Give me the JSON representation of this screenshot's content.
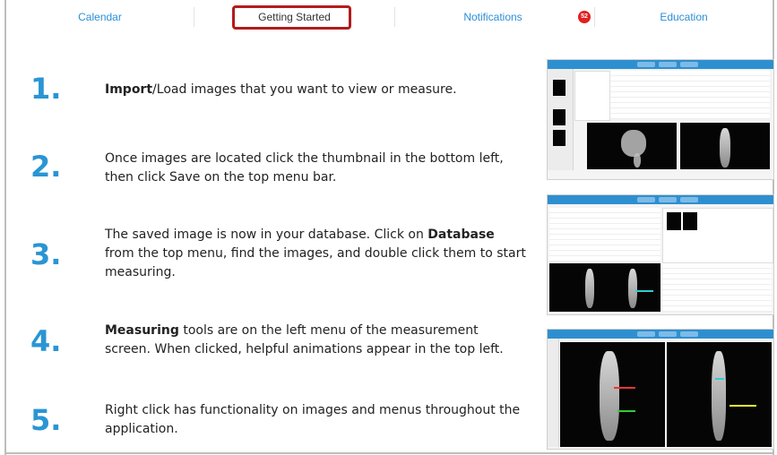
{
  "tabs": [
    {
      "label": "Calendar"
    },
    {
      "label": "Getting Started"
    },
    {
      "label": "Notifications"
    },
    {
      "label": "Education"
    }
  ],
  "notifications_badge": "52",
  "colors": {
    "accent": "#2a95d3",
    "highlight": "#b31b1b",
    "badge": "#e02020"
  },
  "steps": [
    {
      "num": "1.",
      "bold": "Import",
      "text": "/Load images that you want to view or measure."
    },
    {
      "num": "2.",
      "text": "Once images are located click the thumbnail in the bottom left, then click Save on the top menu bar."
    },
    {
      "num": "3.",
      "pre": "The saved image is now in your database. Click on ",
      "bold": "Database",
      "post": " from the top menu, find the images, and double click them to start measuring."
    },
    {
      "num": "4.",
      "bold": "Measuring",
      "text": " tools are on the left menu of the measurement screen. When clicked, helpful animations appear in the top left."
    },
    {
      "num": "5.",
      "text": "Right click has functionality on images and menus throughout the application."
    }
  ],
  "screenshots": [
    {
      "name": "import-screenshot"
    },
    {
      "name": "database-screenshot"
    },
    {
      "name": "measuring-screenshot"
    }
  ]
}
